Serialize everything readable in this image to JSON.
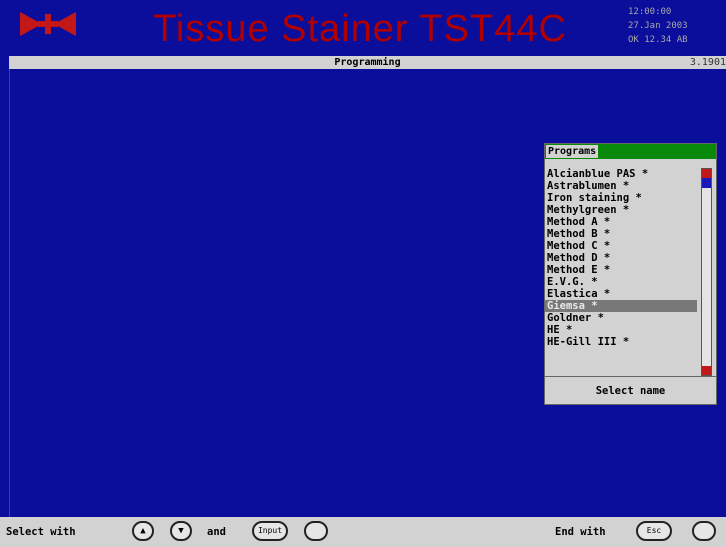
{
  "header": {
    "logo_icon": "double-arrow-logo-icon",
    "title": "Tissue Stainer TST44C",
    "status_lines": [
      "12:00:00",
      "27.Jan 2003",
      "OK 12.34 AB"
    ],
    "colors": {
      "title": "#b20000",
      "background": "#0a0e9a"
    }
  },
  "subheader": {
    "label": "Programming",
    "version": "3.1901"
  },
  "programs_panel": {
    "title": "Programs",
    "items": [
      "Alcianblue PAS *",
      "Astrablumen *",
      "Iron staining *",
      "Methylgreen *",
      "Method A *",
      "Method B *",
      "Method C *",
      "Method D *",
      "Method E *",
      "E.V.G. *",
      "Elastica *",
      "Giemsa *",
      "Goldner *",
      "HE *",
      "HE-Gill III *"
    ],
    "selected_index": 11,
    "hint": "Select name",
    "colors": {
      "header_bar": "#0a8a0a",
      "scroll_end": "#c01818",
      "scroll_pos": "#1a1ab8"
    }
  },
  "footer": {
    "select_with": "Select with",
    "up_icon": "triangle-up-icon",
    "down_icon": "triangle-down-icon",
    "and": "and",
    "input_key": "Input",
    "end_with": "End with",
    "esc_key": "Esc"
  }
}
